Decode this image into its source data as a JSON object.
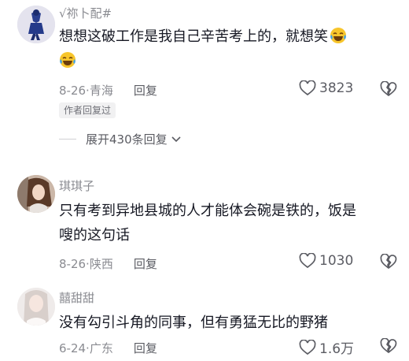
{
  "comments": [
    {
      "username": "√祢卜配#",
      "text_line1": "想想这破工作是我自己辛苦考上的，就想笑",
      "date": "8-26",
      "location": "青海",
      "reply_label": "回复",
      "likes": "3823",
      "badge": "作者回复过",
      "expand_label": "展开430条回复",
      "emoji": "laughing-crying-emoji"
    },
    {
      "username": "琪琪子",
      "text_line1": "只有考到异地县城的人才能体会碗是铁的，饭是",
      "text_line2": "嗖的这句话",
      "date": "8-26",
      "location": "陕西",
      "reply_label": "回复",
      "likes": "1030"
    },
    {
      "username": "囍甜甜",
      "text_line1": "没有勾引斗角的同事，但有勇猛无比的野猪",
      "date": "6-24",
      "location": "广东",
      "reply_label": "回复",
      "likes": "1.6万"
    }
  ],
  "separator": "·",
  "colors": {
    "meta": "#8a8b91",
    "text": "#161823"
  }
}
